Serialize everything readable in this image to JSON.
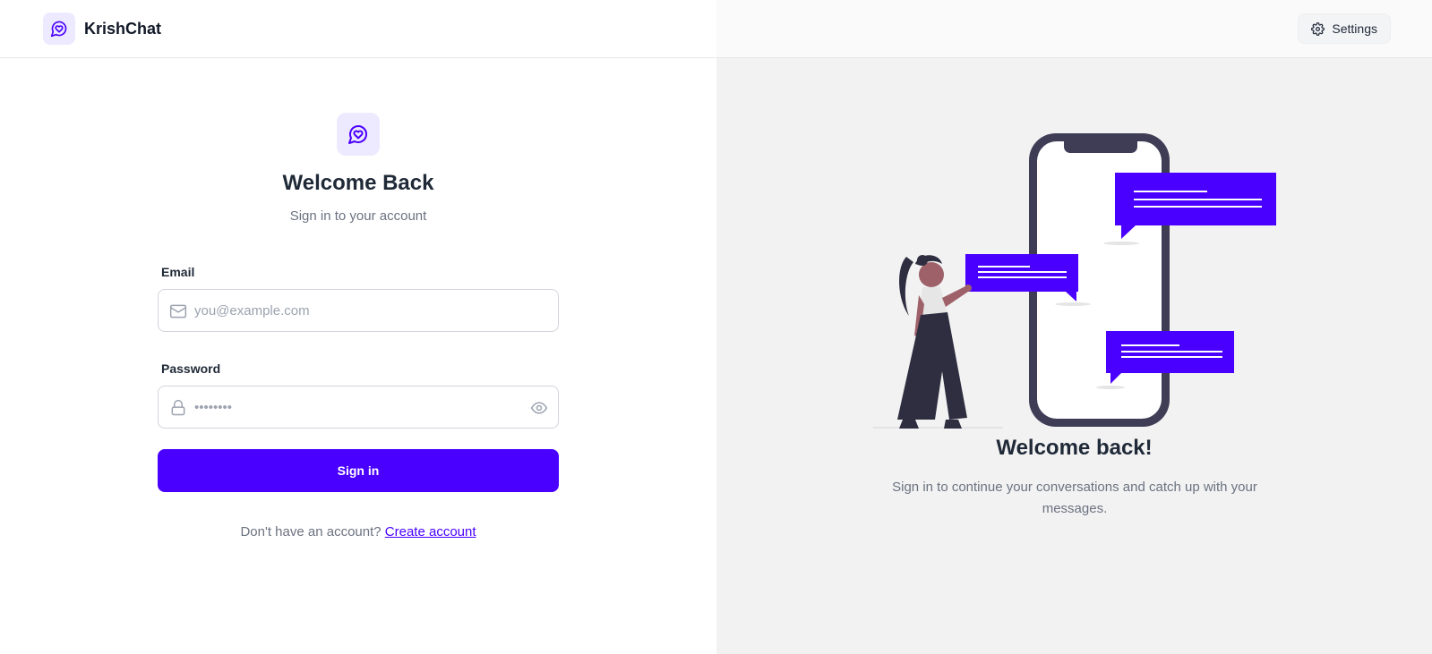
{
  "header": {
    "brand": "KrishChat",
    "settings_label": "Settings"
  },
  "login": {
    "title": "Welcome Back",
    "subtitle": "Sign in to your account",
    "email_label": "Email",
    "email_placeholder": "you@example.com",
    "email_value": "",
    "password_label": "Password",
    "password_placeholder": "••••••••",
    "password_value": "",
    "submit_label": "Sign in",
    "no_account_text": "Don't have an account?",
    "create_account_link": "Create account"
  },
  "promo": {
    "title": "Welcome back!",
    "text": "Sign in to continue your conversations and catch up with your messages."
  },
  "icons": {
    "logo": "chat-heart-icon",
    "settings": "gear-icon",
    "email": "mail-icon",
    "password": "lock-icon",
    "toggle_password": "eye-icon"
  },
  "colors": {
    "primary": "#4a00ff",
    "primary_soft": "#ede9fe",
    "illustration_dark": "#3f3d56"
  }
}
